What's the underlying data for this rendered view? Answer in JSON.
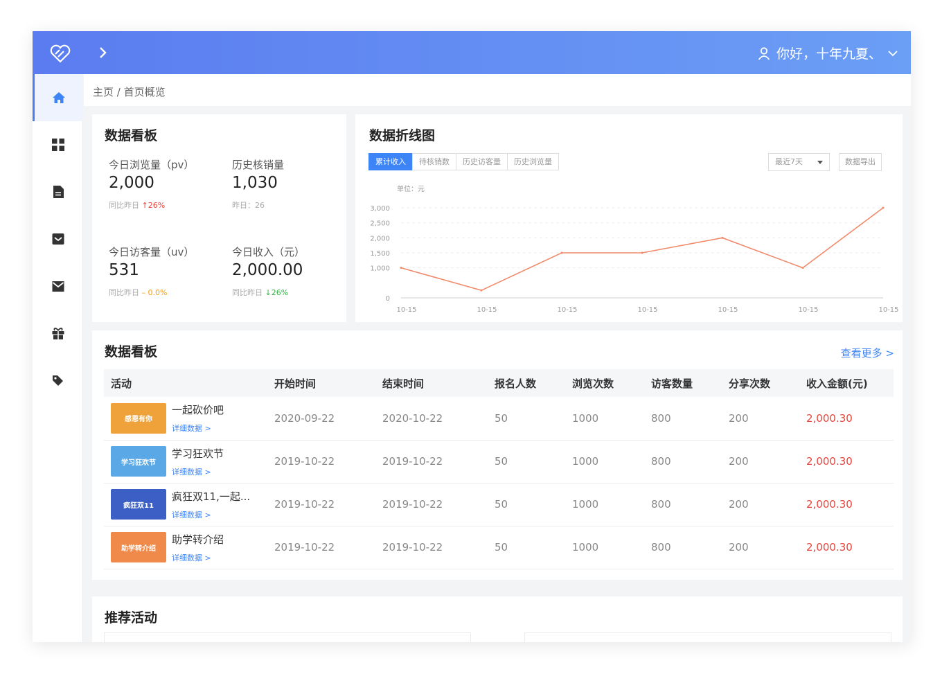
{
  "header": {
    "user_text": "你好，十年九夏、"
  },
  "breadcrumb": "主页 / 首页概览",
  "stats": {
    "title": "数据看板",
    "items": [
      {
        "label": "今日浏览量（pv）",
        "value": "2,000",
        "sub_prefix": "同比昨日",
        "sub_delta": "↑26%",
        "trend": "up"
      },
      {
        "label": "历史核销量",
        "value": "1,030",
        "sub_prefix": "昨日：26",
        "sub_delta": "",
        "trend": "none"
      },
      {
        "label": "今日访客量（uv）",
        "value": "531",
        "sub_prefix": "同比昨日",
        "sub_delta": "– 0.0%",
        "trend": "flat"
      },
      {
        "label": "今日收入（元）",
        "value": "2,000.00",
        "sub_prefix": "同比昨日",
        "sub_delta": "↓26%",
        "trend": "down"
      }
    ]
  },
  "line_card": {
    "title": "数据折线图",
    "tabs": [
      "累计收入",
      "待核销数",
      "历史访客量",
      "历史浏览量"
    ],
    "active_tab": 0,
    "range_select": "最近7天",
    "export_label": "数据导出",
    "unit_label": "单位：元"
  },
  "chart_data": {
    "type": "line",
    "x": [
      "10-15",
      "10-15",
      "10-15",
      "10-15",
      "10-15",
      "10-15",
      "10-15"
    ],
    "series": [
      {
        "values": [
          1000,
          250,
          1500,
          1500,
          2000,
          1000,
          3000
        ],
        "color": "#f08a6a"
      }
    ],
    "ylim": [
      0,
      3000
    ],
    "yticks": [
      "0",
      "1,000",
      "1,500",
      "2,000",
      "2,500",
      "3,000"
    ],
    "grid": true
  },
  "table_card": {
    "title": "数据看板",
    "more_label": "查看更多 >",
    "columns": [
      "活动",
      "开始时间",
      "结束时间",
      "报名人数",
      "浏览次数",
      "访客数量",
      "分享次数",
      "收入金额(元)"
    ],
    "detail_label": "详细数据 >",
    "rows": [
      {
        "name": "一起砍价吧",
        "thumb_text": "感恩有你",
        "thumb_color": "#f0a23a",
        "start": "2020-09-22",
        "end": "2020-10-22",
        "signup": "50",
        "views": "1000",
        "visitors": "800",
        "shares": "200",
        "income": "2,000.30"
      },
      {
        "name": "学习狂欢节",
        "thumb_text": "学习狂欢节",
        "thumb_color": "#5aa9e6",
        "start": "2019-10-22",
        "end": "2019-10-22",
        "signup": "50",
        "views": "1000",
        "visitors": "800",
        "shares": "200",
        "income": "2,000.30"
      },
      {
        "name": "疯狂双11,一起...",
        "thumb_text": "疯狂双11",
        "thumb_color": "#3b5fc4",
        "start": "2019-10-22",
        "end": "2019-10-22",
        "signup": "50",
        "views": "1000",
        "visitors": "800",
        "shares": "200",
        "income": "2,000.30"
      },
      {
        "name": "助学转介绍",
        "thumb_text": "助学转介绍",
        "thumb_color": "#f08a4a",
        "start": "2019-10-22",
        "end": "2019-10-22",
        "signup": "50",
        "views": "1000",
        "visitors": "800",
        "shares": "200",
        "income": "2,000.30"
      }
    ]
  },
  "recommend": {
    "title": "推荐活动"
  },
  "colors": {
    "accent": "#3d84f6",
    "header_start": "#5b7cf0",
    "header_end": "#6b9ef5",
    "income": "#e8443a"
  }
}
